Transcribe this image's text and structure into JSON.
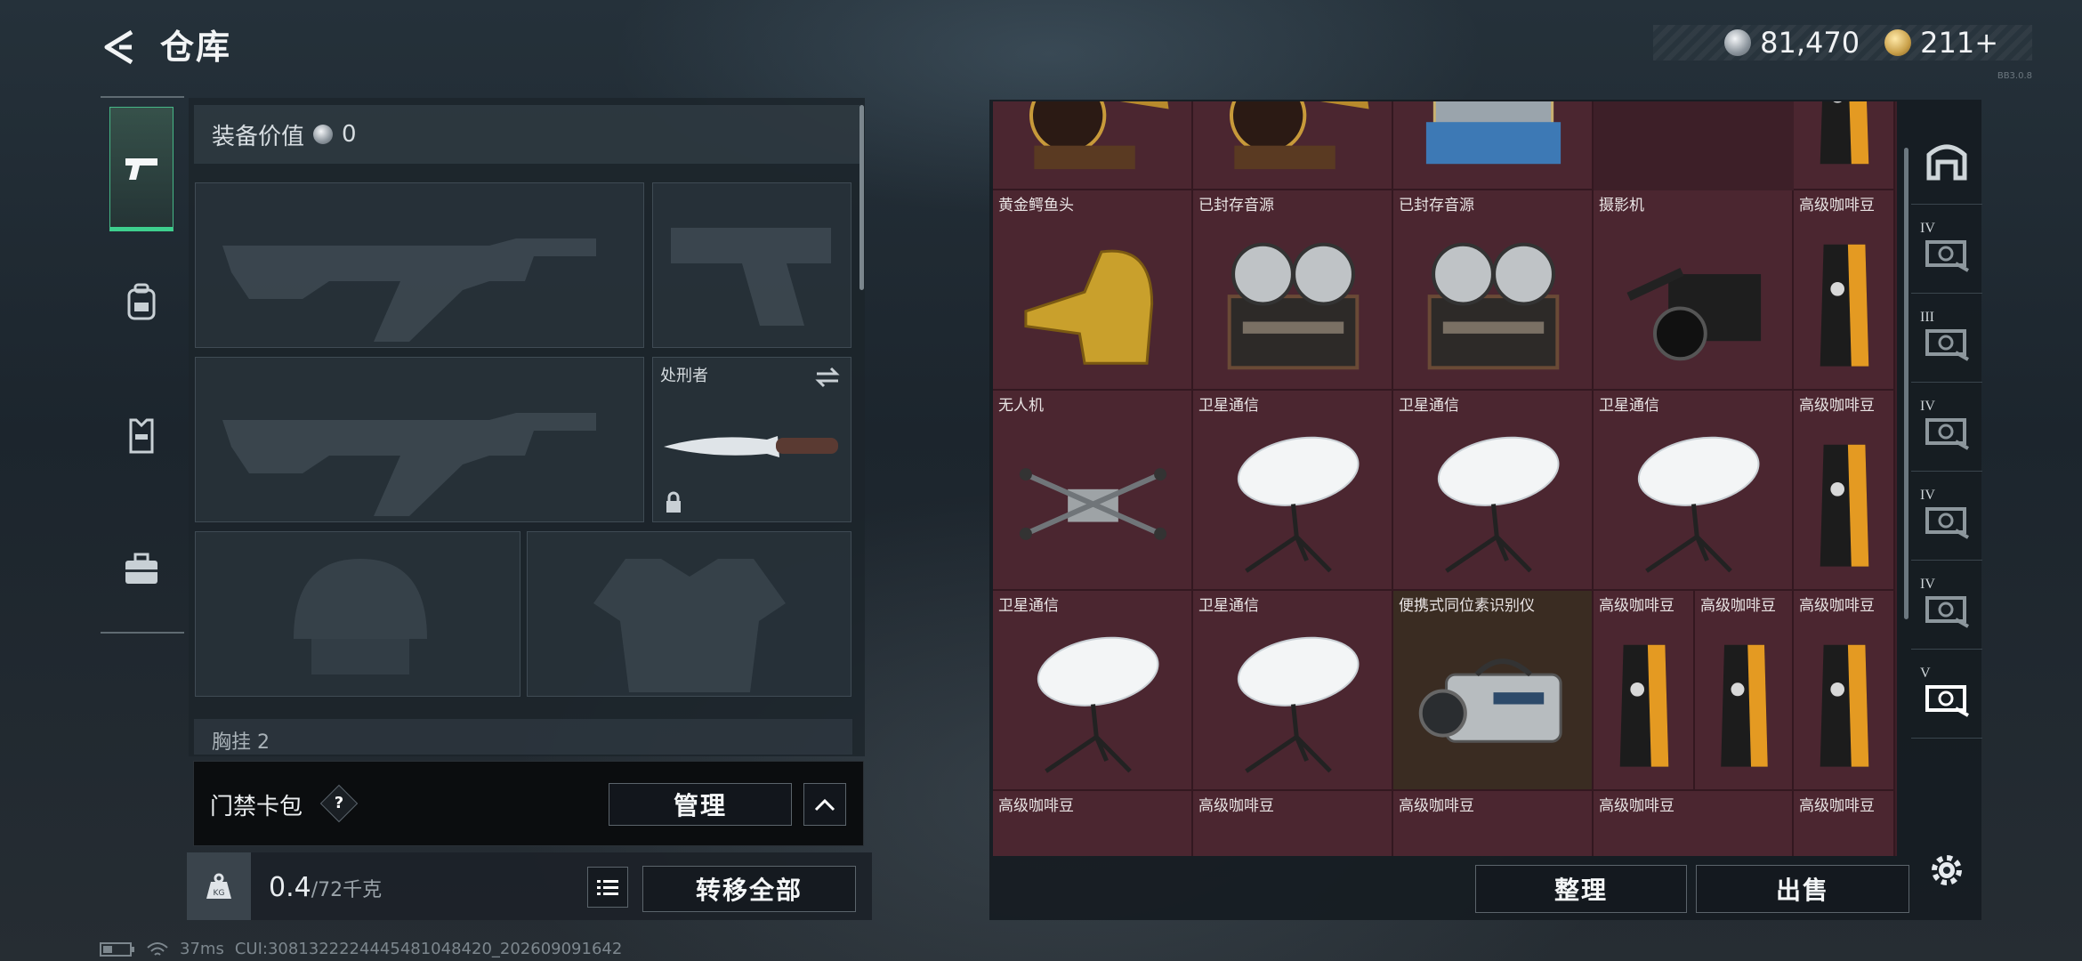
{
  "header": {
    "title": "仓库",
    "silver_amount": "81,470",
    "gold_amount": "211+",
    "version_text": "BB3.0.8"
  },
  "nav": {
    "items": [
      "weapons",
      "backpack",
      "rig",
      "briefcase"
    ]
  },
  "equipment": {
    "value_label": "装备价值",
    "value_amount": "0",
    "melee_name": "处刑者",
    "breast_label": "胸挂",
    "breast_count": "2"
  },
  "keycard": {
    "label": "门禁卡包",
    "help": "?",
    "manage_label": "管理"
  },
  "bottom": {
    "weight_current": "0.4",
    "weight_max": "/72千克",
    "transfer_all_label": "转移全部",
    "kg_icon_text": "KG"
  },
  "storage": {
    "items": [
      {
        "name": "",
        "icon": "gramophone-icon"
      },
      {
        "name": "",
        "icon": "gramophone-icon"
      },
      {
        "name": "",
        "icon": "server-box-icon"
      },
      {
        "name": "",
        "icon": "coffee-bag-icon"
      },
      {
        "name": "黄金鳄鱼头",
        "icon": "gold-croc-head-icon"
      },
      {
        "name": "已封存音源",
        "icon": "reel-tape-icon"
      },
      {
        "name": "已封存音源",
        "icon": "reel-tape-icon"
      },
      {
        "name": "摄影机",
        "icon": "camera-icon"
      },
      {
        "name": "高级咖啡豆",
        "icon": "coffee-bag-icon"
      },
      {
        "name": "无人机",
        "icon": "drone-icon"
      },
      {
        "name": "卫星通信",
        "icon": "satellite-dish-icon"
      },
      {
        "name": "卫星通信",
        "icon": "satellite-dish-icon"
      },
      {
        "name": "卫星通信",
        "icon": "satellite-dish-icon"
      },
      {
        "name": "高级咖啡豆",
        "icon": "coffee-bag-icon"
      },
      {
        "name": "卫星通信",
        "icon": "satellite-dish-icon"
      },
      {
        "name": "卫星通信",
        "icon": "satellite-dish-icon"
      },
      {
        "name": "便携式同位素识别仪",
        "icon": "isotope-scanner-icon"
      },
      {
        "name": "高级咖啡豆",
        "icon": "coffee-bag-icon"
      },
      {
        "name": "高级咖啡豆",
        "icon": "coffee-bag-icon"
      },
      {
        "name": "高级咖啡豆",
        "icon": "coffee-bag-icon"
      },
      {
        "name": "高级咖啡豆",
        "icon": ""
      },
      {
        "name": "高级咖啡豆",
        "icon": ""
      },
      {
        "name": "高级咖啡豆",
        "icon": ""
      },
      {
        "name": "高级咖啡豆",
        "icon": ""
      },
      {
        "name": "高级咖啡豆",
        "icon": ""
      }
    ],
    "tidy_label": "整理",
    "sell_label": "出售"
  },
  "side_tabs": [
    {
      "label": "",
      "icon": "safehouse-icon"
    },
    {
      "label": "IV",
      "icon": "case-icon"
    },
    {
      "label": "III",
      "icon": "case-icon"
    },
    {
      "label": "IV",
      "icon": "case-icon"
    },
    {
      "label": "IV",
      "icon": "case-icon"
    },
    {
      "label": "IV",
      "icon": "case-icon"
    },
    {
      "label": "V",
      "icon": "case-icon"
    }
  ],
  "status_bar": {
    "ping": "37ms",
    "uid": "CUI:3081322224445481048420_202609091642"
  },
  "colors": {
    "accent_green": "#3ecf8e",
    "cell_red": "#4b2630",
    "gold_cell": "#3a2c22"
  }
}
